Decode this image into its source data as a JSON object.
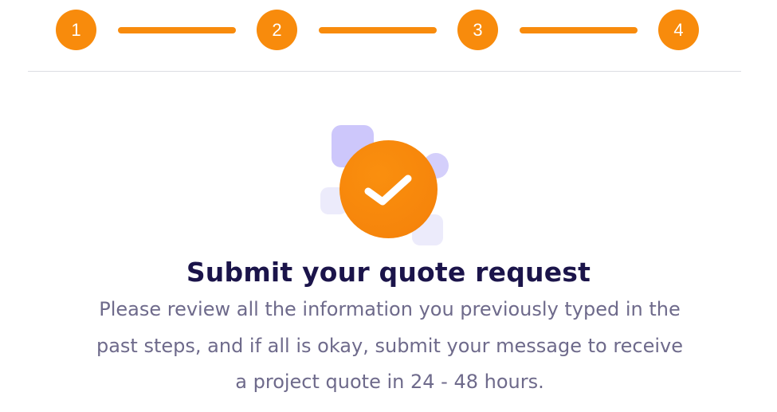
{
  "stepper": {
    "steps": [
      "1",
      "2",
      "3",
      "4"
    ],
    "accent_color": "#f88b0c",
    "current_step": 4
  },
  "illustration": {
    "icon": "checkmark-icon",
    "circle_color": "#f88b0c",
    "decor_color": "#cdc7fb"
  },
  "content": {
    "title": "Submit your quote request",
    "description": "Please review all the information you previously typed in the past steps, and if all is okay, submit your message to receive a project quote in 24 - 48 hours."
  }
}
